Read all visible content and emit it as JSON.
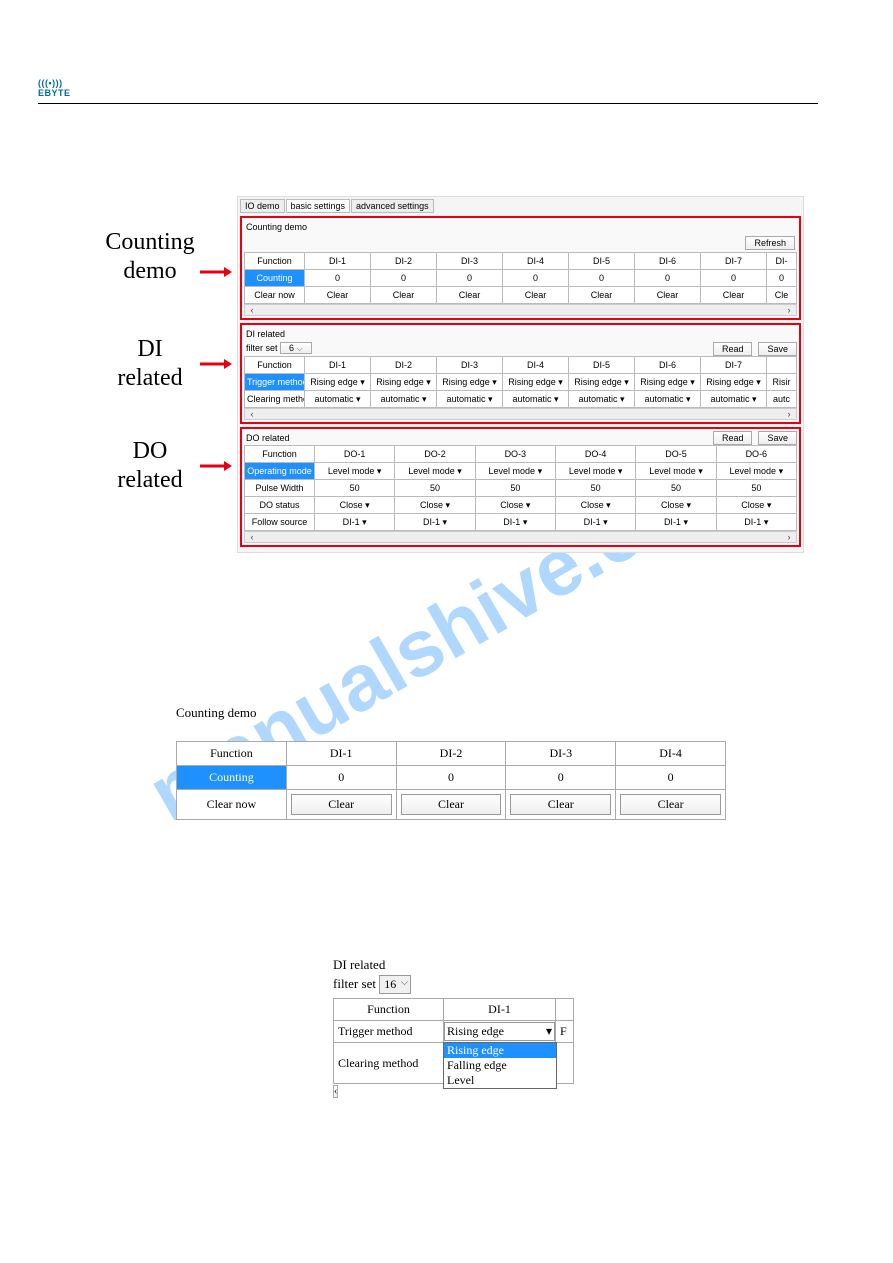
{
  "logo": "EBYTE",
  "tabs": [
    "IO demo",
    "basic settings",
    "advanced settings"
  ],
  "annotations": {
    "counting": "Counting\ndemo",
    "di": "DI\nrelated",
    "do": "DO\nrelated"
  },
  "buttons": {
    "refresh": "Refresh",
    "read": "Read",
    "save": "Save",
    "clear": "Clear"
  },
  "counting_demo": {
    "title": "Counting demo",
    "headers": [
      "Function",
      "DI-1",
      "DI-2",
      "DI-3",
      "DI-4",
      "DI-5",
      "DI-6",
      "DI-7",
      "DI-"
    ],
    "counting_label": "Counting",
    "counting_values": [
      "0",
      "0",
      "0",
      "0",
      "0",
      "0",
      "0",
      "0"
    ],
    "clear_now": "Clear now",
    "clear_partial": "Cle"
  },
  "di_related": {
    "title": "DI related",
    "filter_label": "filter set",
    "filter_value": "6",
    "headers": [
      "Function",
      "DI-1",
      "DI-2",
      "DI-3",
      "DI-4",
      "DI-5",
      "DI-6",
      "DI-7",
      ""
    ],
    "trigger_label": "Trigger method",
    "trigger_val": "Rising edge",
    "trigger_partial": "Risir",
    "clearing_label": "Clearing method",
    "clearing_val": "automatic",
    "clearing_partial": "autc"
  },
  "do_related": {
    "title": "DO related",
    "headers": [
      "Function",
      "DO-1",
      "DO-2",
      "DO-3",
      "DO-4",
      "DO-5",
      "DO-6"
    ],
    "op_mode": "Operating mode",
    "level": "Level mode",
    "pulse": "Pulse Width",
    "pulse_val": "50",
    "dostatus": "DO status",
    "close": "Close",
    "follow": "Follow source",
    "di1": "DI-1"
  },
  "fig2": {
    "title": "Counting demo",
    "headers": [
      "Function",
      "DI-1",
      "DI-2",
      "DI-3",
      "DI-4"
    ],
    "counting": "Counting",
    "vals": [
      "0",
      "0",
      "0",
      "0"
    ],
    "clearnow": "Clear now",
    "clear": "Clear"
  },
  "fig3": {
    "title": "DI related",
    "filter_label": "filter set",
    "filter_value": "16",
    "function": "Function",
    "di1": "DI-1",
    "trigger": "Trigger method",
    "rising": "Rising edge",
    "clearing": "Clearing method",
    "f": "F",
    "opts": [
      "Rising edge",
      "Falling edge",
      "Level"
    ]
  },
  "watermark": "manualshive.com"
}
